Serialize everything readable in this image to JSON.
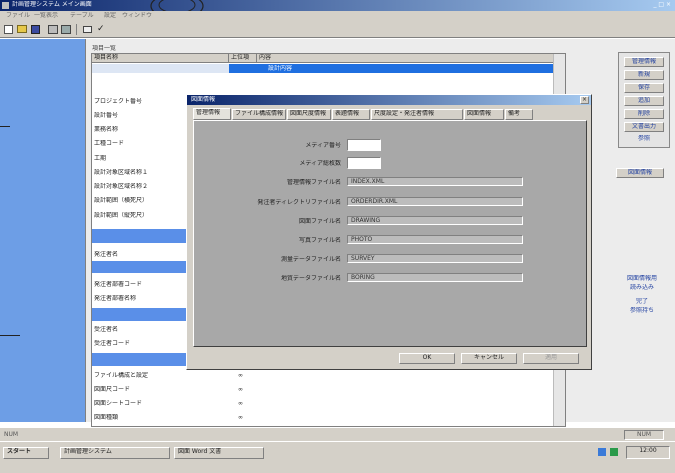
{
  "window": {
    "title": "計画管理システム メイン画面",
    "controls": "_ □ ×"
  },
  "menu": [
    "ファイル",
    "一覧表示",
    "テーブル",
    "設定",
    "ウィンドウ"
  ],
  "list": {
    "caption": "項目一覧",
    "columns": [
      "項目名称",
      "上位項",
      "内容"
    ],
    "selected_text": "設計内容",
    "rows": [
      "プロジェクト番号",
      "設計番号",
      "業務名称",
      "工種コード",
      "工期",
      "設計対象区域名称１",
      "設計対象区域名称２",
      "設計範囲（横死尺）",
      "設計範囲（縦死尺）",
      "",
      "発注者名",
      "",
      "発注者部署コード",
      "発注者部署名称",
      "",
      "受注者名",
      "受注者コード",
      "",
      "ファイル構成と設定",
      "図面尺コード",
      "図面シートコード",
      "図面種類"
    ],
    "bottom_values": [
      "∞",
      "∞",
      "∞",
      "∞"
    ]
  },
  "dialog": {
    "title": "図面情報",
    "tabs": [
      "管理情報",
      "ファイル構成情報",
      "図面尺度情報",
      "表題情報",
      "尺度設定・発注者情報",
      "図面情報",
      "備考"
    ],
    "fields": [
      {
        "label": "メディア番号",
        "value": ""
      },
      {
        "label": "メディア総枚数",
        "value": ""
      },
      {
        "label": "管理情報ファイル名",
        "value": "INDEX.XML"
      },
      {
        "label": "発注者ディレクトリファイル名",
        "value": "ORDERDIR.XML"
      },
      {
        "label": "図面ファイル名",
        "value": "DRAWING"
      },
      {
        "label": "写真ファイル名",
        "value": "PHOTO"
      },
      {
        "label": "測量データファイル名",
        "value": "SURVEY"
      },
      {
        "label": "地質データファイル名",
        "value": "BORING"
      }
    ],
    "buttons": [
      "OK",
      "キャンセル",
      "適用"
    ]
  },
  "right_panel": {
    "buttons": [
      "管理情報",
      "新規",
      "保存",
      "追加",
      "削除",
      "文書出力",
      "参照"
    ],
    "single_button": "図面情報",
    "note_lines": [
      "図面情報用",
      "読み込み",
      "完了",
      "参照持ち"
    ]
  },
  "status_bar": {
    "left": "NUM",
    "right": "NUM"
  },
  "taskbar": {
    "start": "スタート",
    "tasks": [
      "計画管理システム",
      "図面 Word 文書"
    ],
    "clock": "12:00"
  }
}
